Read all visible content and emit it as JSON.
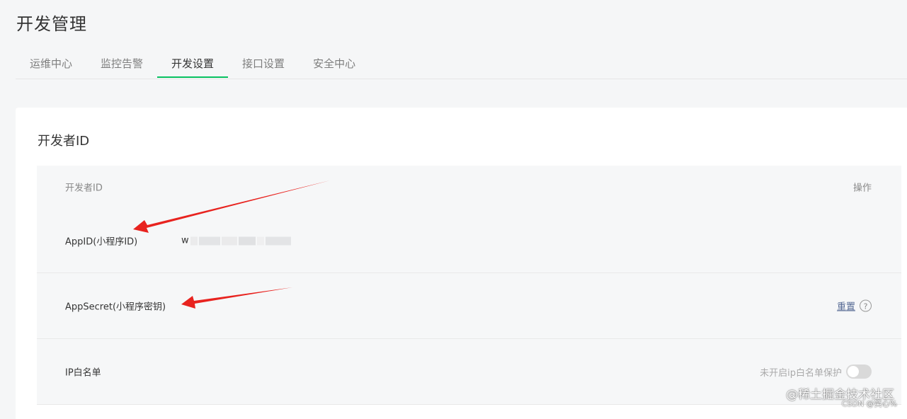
{
  "page_title": "开发管理",
  "tabs": [
    {
      "label": "运维中心",
      "active": false
    },
    {
      "label": "监控告警",
      "active": false
    },
    {
      "label": "开发设置",
      "active": true
    },
    {
      "label": "接口设置",
      "active": false
    },
    {
      "label": "安全中心",
      "active": false
    }
  ],
  "section": {
    "title": "开发者ID",
    "table": {
      "header": {
        "label": "开发者ID",
        "operation": "操作"
      },
      "rows": [
        {
          "label": "AppID(小程序ID)",
          "value_prefix": "w"
        },
        {
          "label": "AppSecret(小程序密钥)",
          "action_label": "重置",
          "help_icon": "help-circle-icon",
          "help_glyph": "?"
        },
        {
          "label": "IP白名单",
          "toggle_label": "未开启ip白名单保护",
          "toggle_on": false
        }
      ]
    }
  },
  "watermark": {
    "line1": "@稀土掘金技术社区",
    "line2": "CSDN @笑心%"
  },
  "colors": {
    "accent_green": "#07c160",
    "link_blue": "#576b95",
    "annotation_red": "#e8231f",
    "page_bg": "#f5f6f7",
    "row_bg": "#f6f7f8"
  }
}
